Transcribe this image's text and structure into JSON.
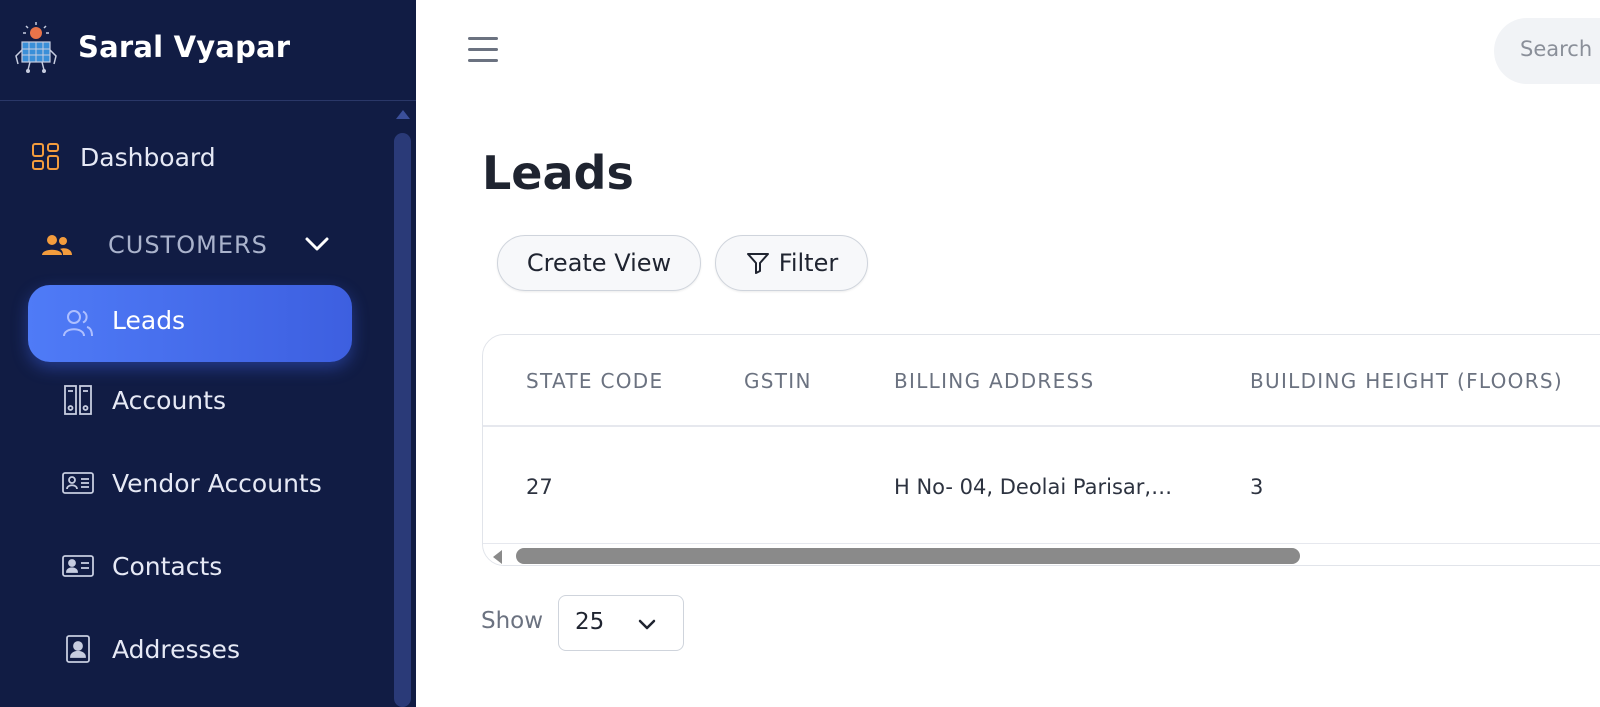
{
  "brand": {
    "name": "Saral Vyapar",
    "logo_icon": "solar-robot-logo"
  },
  "sidebar": {
    "dashboard": {
      "label": "Dashboard",
      "icon": "grid-icon"
    },
    "customers_section": {
      "label": "CUSTOMERS",
      "icon": "users-icon",
      "expanded": true
    },
    "items": [
      {
        "label": "Leads",
        "icon": "users-outline-icon",
        "active": true
      },
      {
        "label": "Accounts",
        "icon": "binders-icon",
        "active": false
      },
      {
        "label": "Vendor Accounts",
        "icon": "vendor-card-icon",
        "active": false
      },
      {
        "label": "Contacts",
        "icon": "id-card-icon",
        "active": false
      },
      {
        "label": "Addresses",
        "icon": "address-book-icon",
        "active": false
      }
    ]
  },
  "topbar": {
    "search_placeholder": "Search r"
  },
  "main": {
    "title": "Leads",
    "buttons": {
      "create_view": "Create View",
      "filter": "Filter"
    },
    "table": {
      "columns": [
        "STATE CODE",
        "GSTIN",
        "BILLING ADDRESS",
        "BUILDING HEIGHT (FLOORS)"
      ],
      "rows": [
        [
          "27",
          "",
          "H No- 04, Deolai Parisar,…",
          "3"
        ]
      ]
    },
    "pagination": {
      "show_label": "Show",
      "page_size": "25"
    }
  },
  "colors": {
    "sidebar_bg": "#111c44",
    "active_item": "#4f7bf7",
    "accent_orange": "#f39c3d"
  }
}
